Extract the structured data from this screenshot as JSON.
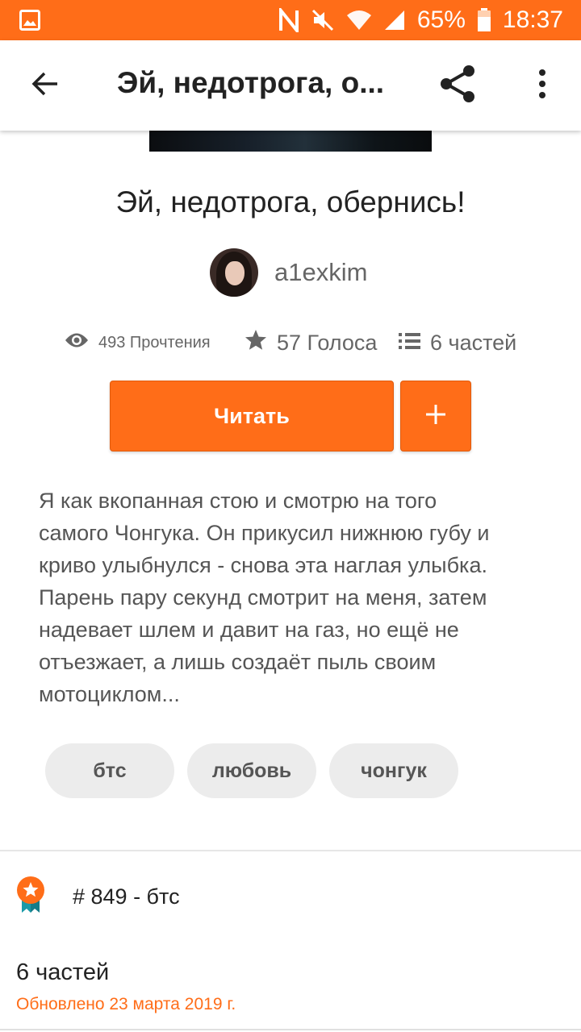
{
  "status_bar": {
    "battery": "65%",
    "time": "18:37"
  },
  "app_bar": {
    "title": "Эй, недотрога, о..."
  },
  "story": {
    "title": "Эй, недотрога, обернись!",
    "author": "a1exkim",
    "stats": {
      "reads": "493 Прочтения",
      "votes": "57 Голоса",
      "parts": "6 частей"
    },
    "read_button": "Читать",
    "add_button": "+",
    "description_lines": [
      "Я как вкопанная стою и смотрю на того",
      "самого Чонгука. Он прикусил нижнюю губу и",
      "криво улыбнулся - снова эта наглая улыбка.",
      "Парень пару секунд смотрит на меня, затем",
      "надевает шлем и давит на газ, но ещё не",
      "отъезжает, а лишь создаёт пыль своим",
      "мотоциклом..."
    ],
    "tags": [
      "бтс",
      "любовь",
      "чонгук"
    ],
    "rank": "# 849 - бтс",
    "parts_heading": "6 частей",
    "updated": "Обновлено 23 марта 2019 г."
  },
  "colors": {
    "accent": "#ff6d18",
    "text_primary": "#222222",
    "text_secondary": "#666666",
    "tag_background": "#ececec",
    "rank_badge_teal": "#1a9aa8"
  },
  "icons": {
    "status_left": "gallery-icon",
    "nfc": "nfc-icon",
    "mute": "mute-icon",
    "wifi": "wifi-icon",
    "signal": "signal-icon",
    "battery": "battery-icon",
    "back": "arrow-back-icon",
    "share": "share-icon",
    "more": "more-vert-icon",
    "reads": "eye-icon",
    "votes": "star-icon",
    "parts": "list-icon",
    "rank": "rank-badge-icon"
  }
}
